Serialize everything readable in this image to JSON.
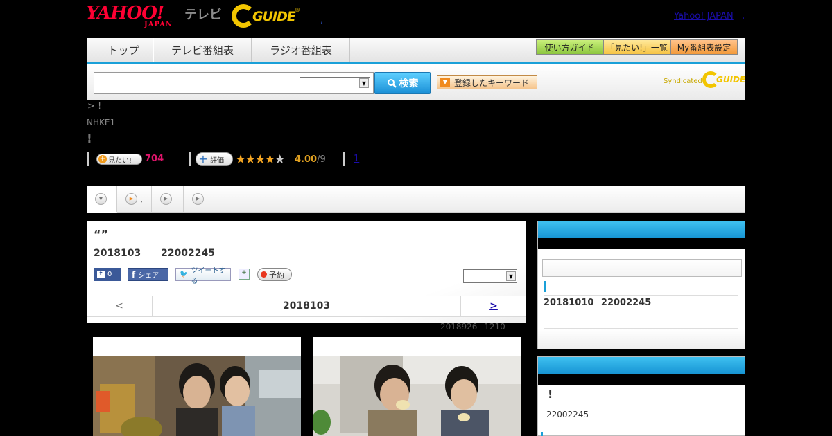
{
  "header": {
    "yahoo_logo": "YAHOO!",
    "yahoo_logo_sub": "JAPAN",
    "tv_label": "テレビ",
    "gguide_logo": "GUIDE",
    "yahoo_japan_link": "Yahoo! JAPAN",
    "link_separator": ","
  },
  "nav": {
    "tabs": [
      "トップ",
      "テレビ番組表",
      "ラジオ番組表"
    ],
    "buttons": [
      "使い方ガイド",
      "「見たい!」一覧",
      "My番組表設定"
    ]
  },
  "search": {
    "input_value": "",
    "select_value": "",
    "button_label": "検索",
    "keyword_button": "登録したキーワード",
    "syndicated_label": "Syndicated",
    "syndicated_logo": "GUIDE"
  },
  "program": {
    "breadcrumb": "> !",
    "channel": "NHKE1",
    "title_excl": "!",
    "mitai_label": "見たい!",
    "mitai_count": "704",
    "hyouka_label": "評価",
    "stars_filled": 4,
    "rating": "4.00",
    "rating_den": "/9",
    "review_link": "1"
  },
  "tabs": {
    "items": [
      "",
      ",",
      "",
      ""
    ]
  },
  "card": {
    "quote": "“”",
    "date": "2018103",
    "time": "22002245",
    "fb_count": "0",
    "fb_share": "シェア",
    "tweet": "ツイートする",
    "reserve": "予約",
    "select_value": "",
    "pager_prev": "<",
    "pager_current": "2018103",
    "pager_next": ">",
    "updated_date": "2018926",
    "updated_time": "1210"
  },
  "sidebar": {
    "panel1_date": "20181010",
    "panel1_time": "22002245",
    "panel2_excl": "!",
    "panel2_time": "22002245"
  },
  "colors": {
    "accent_blue": "#1aa0d8",
    "mitai_pink": "#e0156b",
    "star_gold": "#f5a623"
  }
}
